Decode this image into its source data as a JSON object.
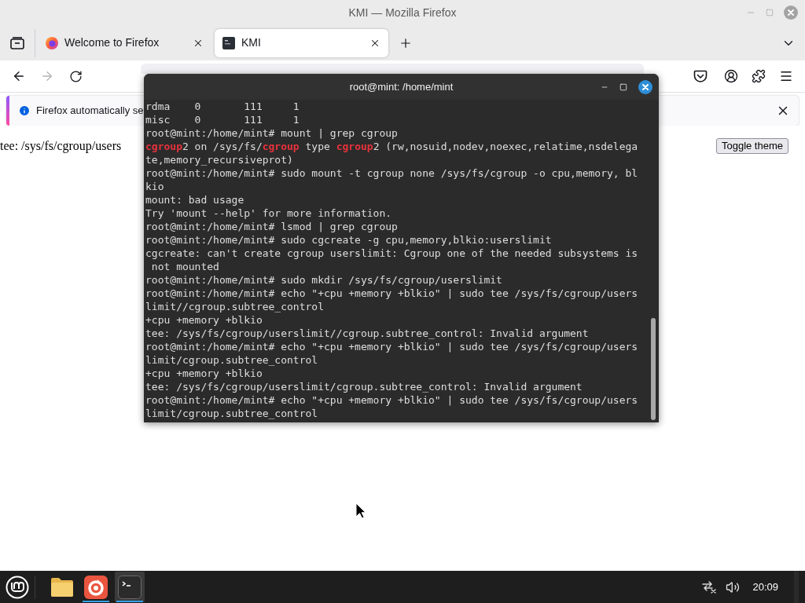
{
  "window": {
    "title": "KMI — Mozilla Firefox"
  },
  "tabs": [
    {
      "title": "Welcome to Firefox",
      "selected": false
    },
    {
      "title": "KMI",
      "selected": true
    }
  ],
  "nav": {
    "back": {
      "disabled": false
    },
    "forward": {
      "disabled": true
    }
  },
  "notification": {
    "text": "Firefox automatically se"
  },
  "page": {
    "text": "tee: /sys/fs/cgroup/users",
    "button": "Toggle theme"
  },
  "terminal": {
    "title": "root@mint: /home/mint",
    "lines": [
      "rdma    0       111     1",
      "misc    0       111     1",
      "root@mint:/home/mint# mount | grep cgroup",
      "**cgroup**2 on /sys/fs/**cgroup** type **cgroup**2 (rw,nosuid,nodev,noexec,relatime,nsdelega",
      "te,memory_recursiveprot)",
      "root@mint:/home/mint# sudo mount -t cgroup none /sys/fs/cgroup -o cpu,memory, bl",
      "kio",
      "mount: bad usage",
      "Try 'mount --help' for more information.",
      "root@mint:/home/mint# lsmod | grep cgroup",
      "root@mint:/home/mint# sudo cgcreate -g cpu,memory,blkio:userslimit",
      "cgcreate: can't create cgroup userslimit: Cgroup one of the needed subsystems is",
      " not mounted",
      "root@mint:/home/mint# sudo mkdir /sys/fs/cgroup/userslimit",
      "root@mint:/home/mint# echo \"+cpu +memory +blkio\" | sudo tee /sys/fs/cgroup/users",
      "limit//cgroup.subtree_control",
      "+cpu +memory +blkio",
      "tee: /sys/fs/cgroup/userslimit//cgroup.subtree_control: Invalid argument",
      "root@mint:/home/mint# echo \"+cpu +memory +blkio\" | sudo tee /sys/fs/cgroup/users",
      "limit/cgroup.subtree_control",
      "+cpu +memory +blkio",
      "tee: /sys/fs/cgroup/userslimit/cgroup.subtree_control: Invalid argument",
      "root@mint:/home/mint# echo \"+cpu +memory +blkio\" | sudo tee /sys/fs/cgroup/users",
      "limit/cgroup.subtree_control"
    ]
  },
  "taskbar": {
    "apps": [
      {
        "running": false,
        "selected": false
      },
      {
        "running": true,
        "selected": false
      },
      {
        "running": true,
        "selected": true
      }
    ],
    "clock": "20:09"
  }
}
